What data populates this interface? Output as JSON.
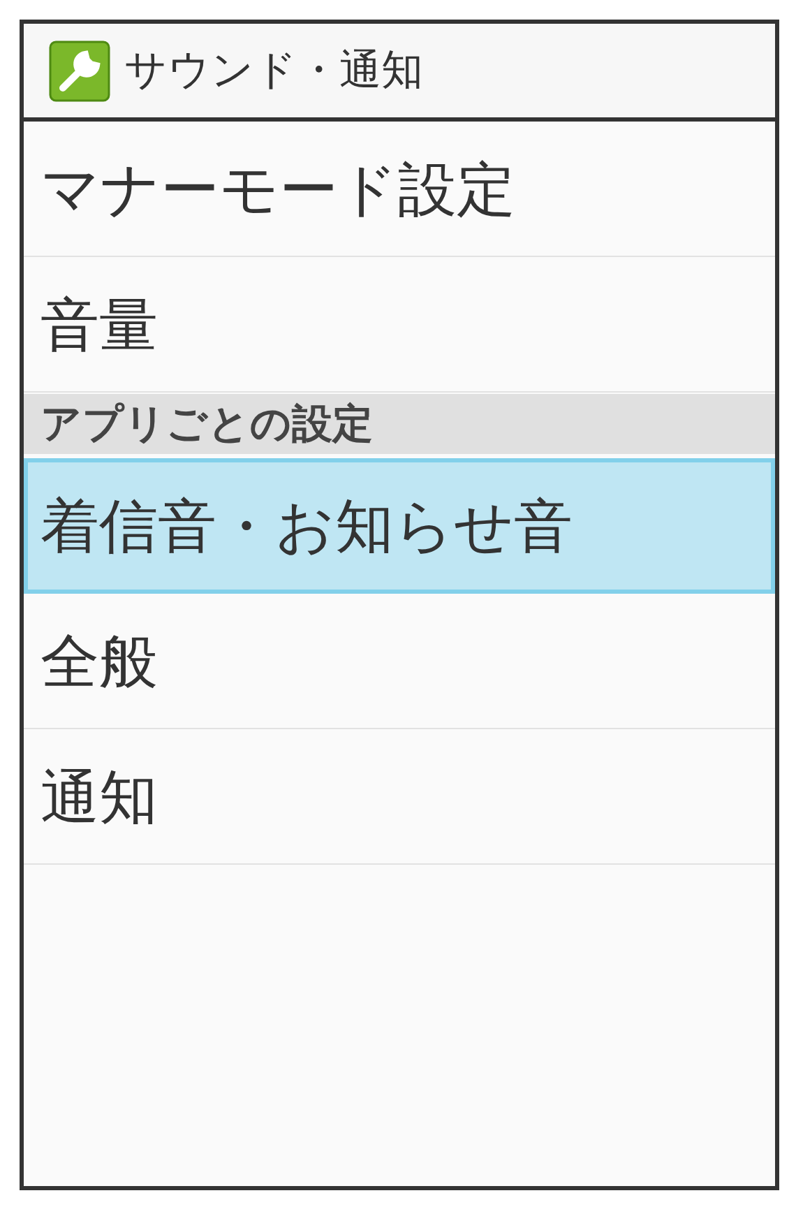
{
  "header": {
    "title": "サウンド・通知"
  },
  "items": [
    {
      "kind": "item",
      "label": "マナーモード設定",
      "selected": false
    },
    {
      "kind": "item",
      "label": "音量",
      "selected": false
    },
    {
      "kind": "section",
      "label": "アプリごとの設定"
    },
    {
      "kind": "item",
      "label": "着信音・お知らせ音",
      "selected": true
    },
    {
      "kind": "item",
      "label": "全般",
      "selected": false
    },
    {
      "kind": "item",
      "label": "通知",
      "selected": false
    }
  ]
}
